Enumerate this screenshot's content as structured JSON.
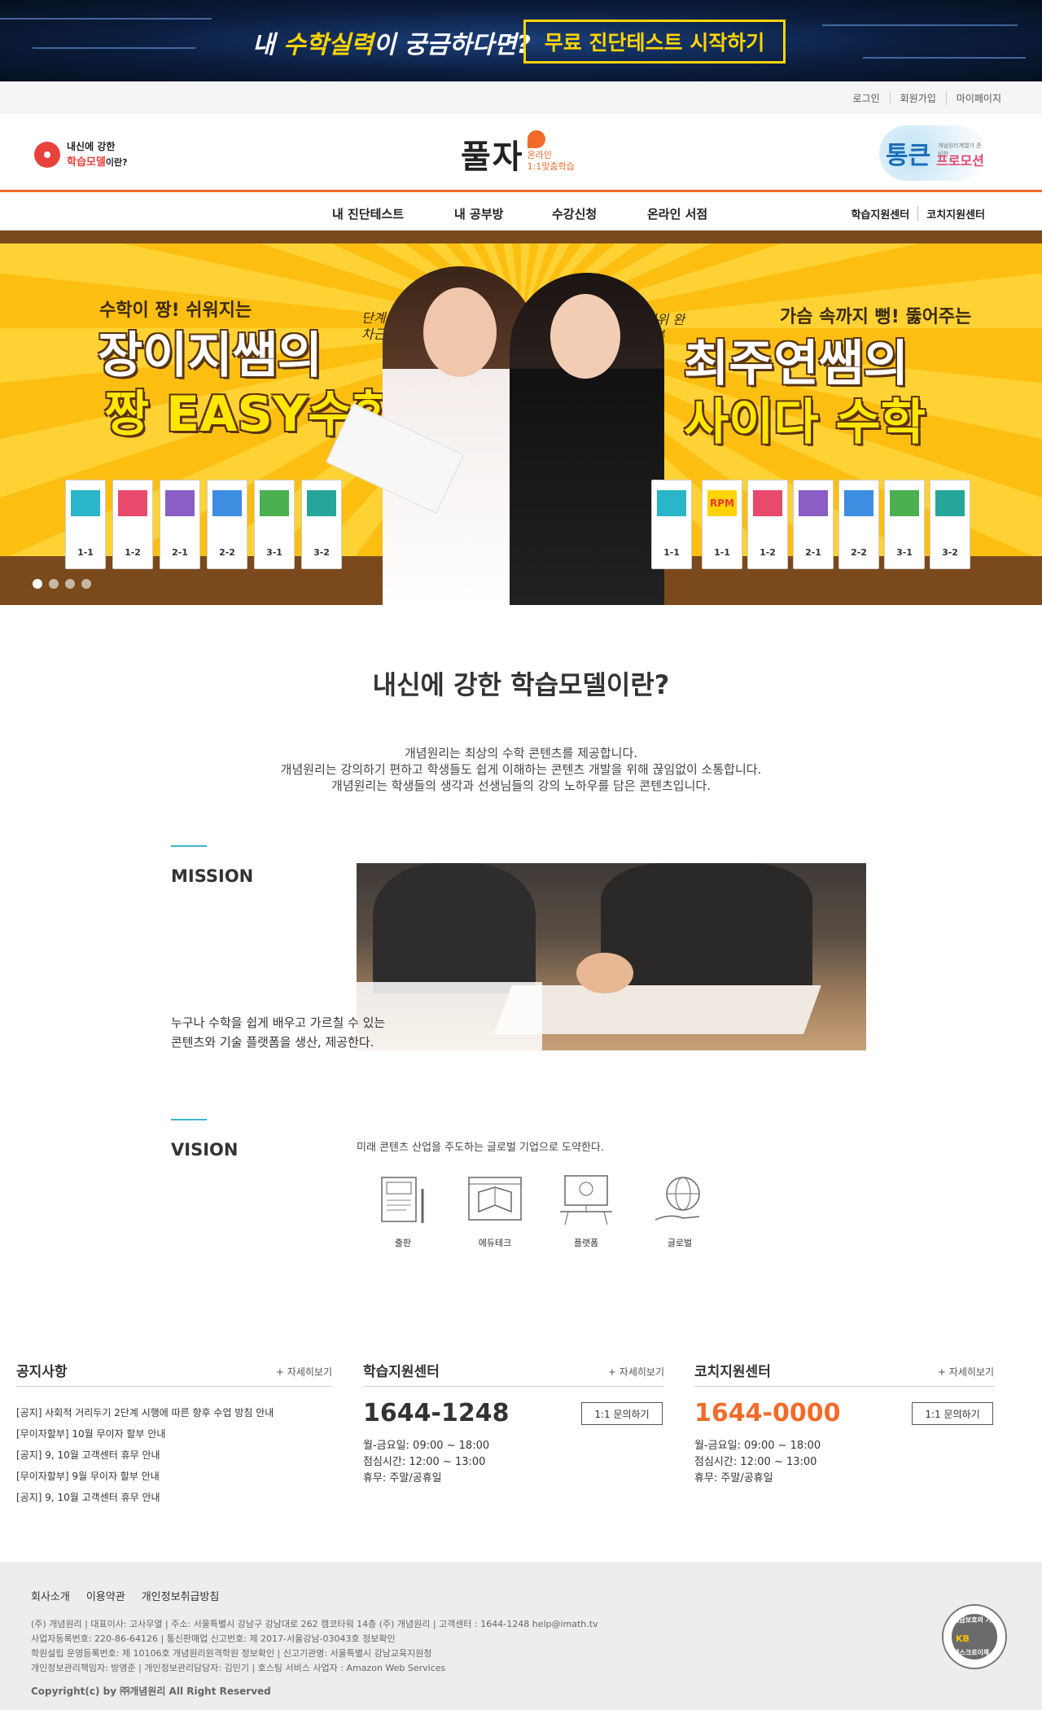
{
  "promo": {
    "text_prefix": "내 ",
    "text_highlight": "수학실력",
    "text_suffix": "이 궁금하다면?",
    "button": "무료 진단테스트 시작하기"
  },
  "utility_nav": [
    "로그인",
    "회원가입",
    "마이페이지"
  ],
  "header": {
    "model_line1": "내신에 강한",
    "model_line2": "학습모델",
    "model_line2_suffix": "이란?",
    "logo_main": "풀자",
    "logo_sub1": "온라인",
    "logo_sub2": "1:1맞춤학습",
    "partner_big": "통큰",
    "partner_small": "프로모션",
    "partner_tiny": "개념원리계열가 준비한"
  },
  "main_nav": {
    "items": [
      "내 진단테스트",
      "내 공부방",
      "수강신청",
      "온라인 서점"
    ],
    "right": [
      "학습지원센터",
      "코치지원센터"
    ]
  },
  "banner": {
    "left_small": "수학이 짱! 쉬워지는",
    "left_big1": "장이지쌤의",
    "left_big2": "짱 EASY수학",
    "left_hand": "단계별로 차근차근",
    "right_small": "가슴 속까지 뻥! 뚫어주는",
    "right_big1": "최주연쌤의",
    "right_big2": "사이다 수학",
    "right_hand": "전 범위 완전정복",
    "books_left": [
      "1-1",
      "1-2",
      "2-1",
      "2-2",
      "3-1",
      "3-2"
    ],
    "books_right": [
      "1-1",
      "1-1",
      "1-2",
      "2-1",
      "2-2",
      "3-1",
      "3-2"
    ],
    "rpm_label": "RPM",
    "slide_count": 4
  },
  "intro": {
    "title": "내신에 강한 학습모델이란?",
    "lines": [
      "개념원리는 최상의 수학 콘텐츠를 제공합니다.",
      "개념원리는 강의하기 편하고 학생들도 쉽게 이해하는 콘텐츠 개발을 위해 끊임없이 소통합니다.",
      "개념원리는 학생들의 생각과 선생님들의 강의 노하우를 담은 콘텐츠입니다."
    ]
  },
  "mission": {
    "label": "MISSION",
    "line1": "누구나 수학을 쉽게 배우고 가르칠 수 있는",
    "line2": "콘텐츠와 기술 플랫폼을 생산, 제공한다."
  },
  "vision": {
    "label": "VISION",
    "desc": "미래 콘텐츠 산업을 주도하는 글로벌 기업으로 도약한다.",
    "items": [
      {
        "label": "출판",
        "icon": "book-pen-icon"
      },
      {
        "label": "에듀테크",
        "icon": "screen-book-icon"
      },
      {
        "label": "플랫폼",
        "icon": "lightbulb-desk-icon"
      },
      {
        "label": "글로벌",
        "icon": "globe-hand-icon"
      }
    ]
  },
  "notice": {
    "title": "공지사항",
    "more": "+ 자세히보기",
    "items": [
      "[공지] 사회적 거리두기 2단계 시행에 따른 향후 수업 방침 안내",
      "[무이자할부] 10월 무이자 할부 안내",
      "[공지] 9, 10월 고객센터 휴무 안내",
      "[무이자할부] 9월 무이자 할부 안내",
      "[공지] 9, 10월 고객센터 휴무 안내"
    ]
  },
  "learning_center": {
    "title": "학습지원센터",
    "more": "+ 자세히보기",
    "phone": "1644-1248",
    "button": "1:1 문의하기",
    "hours": [
      "월-금요일: 09:00 ~ 18:00",
      "점심시간: 12:00 ~ 13:00",
      "휴무: 주말/공휴일"
    ]
  },
  "coach_center": {
    "title": "코치지원센터",
    "more": "+ 자세히보기",
    "phone": "1644-0000",
    "button": "1:1 문의하기",
    "hours": [
      "월-금요일: 09:00 ~ 18:00",
      "점심시간: 12:00 ~ 13:00",
      "휴무: 주말/공휴일"
    ]
  },
  "footer": {
    "links": [
      "회사소개",
      "이용약관",
      "개인정보취급방침"
    ],
    "info": [
      "(주) 개념원리 | 대표이사: 고사무열 | 주소: 서울특별시 강남구 강남대로 262 캠코타워 14층 (주) 개념원리 | 고객센터 : 1644-1248   help@imath.tv",
      "사업자등록번호: 220-86-64126 | 통신판매업 신고번호: 제 2017-서울강남-03043호 정보확인",
      "학원설립 운영등록번호: 제 10106호 개념원리원격학원 정보확인 | 신고기관명: 서울특별시 강남교육지원청",
      "개인정보관리책임자: 방영준 | 개인정보관리담당자: 김민기 | 호스팅 서비스 사업자 : Amazon Web Services"
    ],
    "copyright": "Copyright(c) by ㈜개념원리 All Right Reserved",
    "escrow_top": "에스크로이체",
    "escrow_kb": "KB",
    "escrow_bottom": "예금보호의 기준"
  },
  "colors": {
    "accent_orange": "#f26b2a",
    "promo_yellow": "#ffd400",
    "banner_yellow": "#fdc215",
    "teal_accent": "#3fb5c6"
  }
}
